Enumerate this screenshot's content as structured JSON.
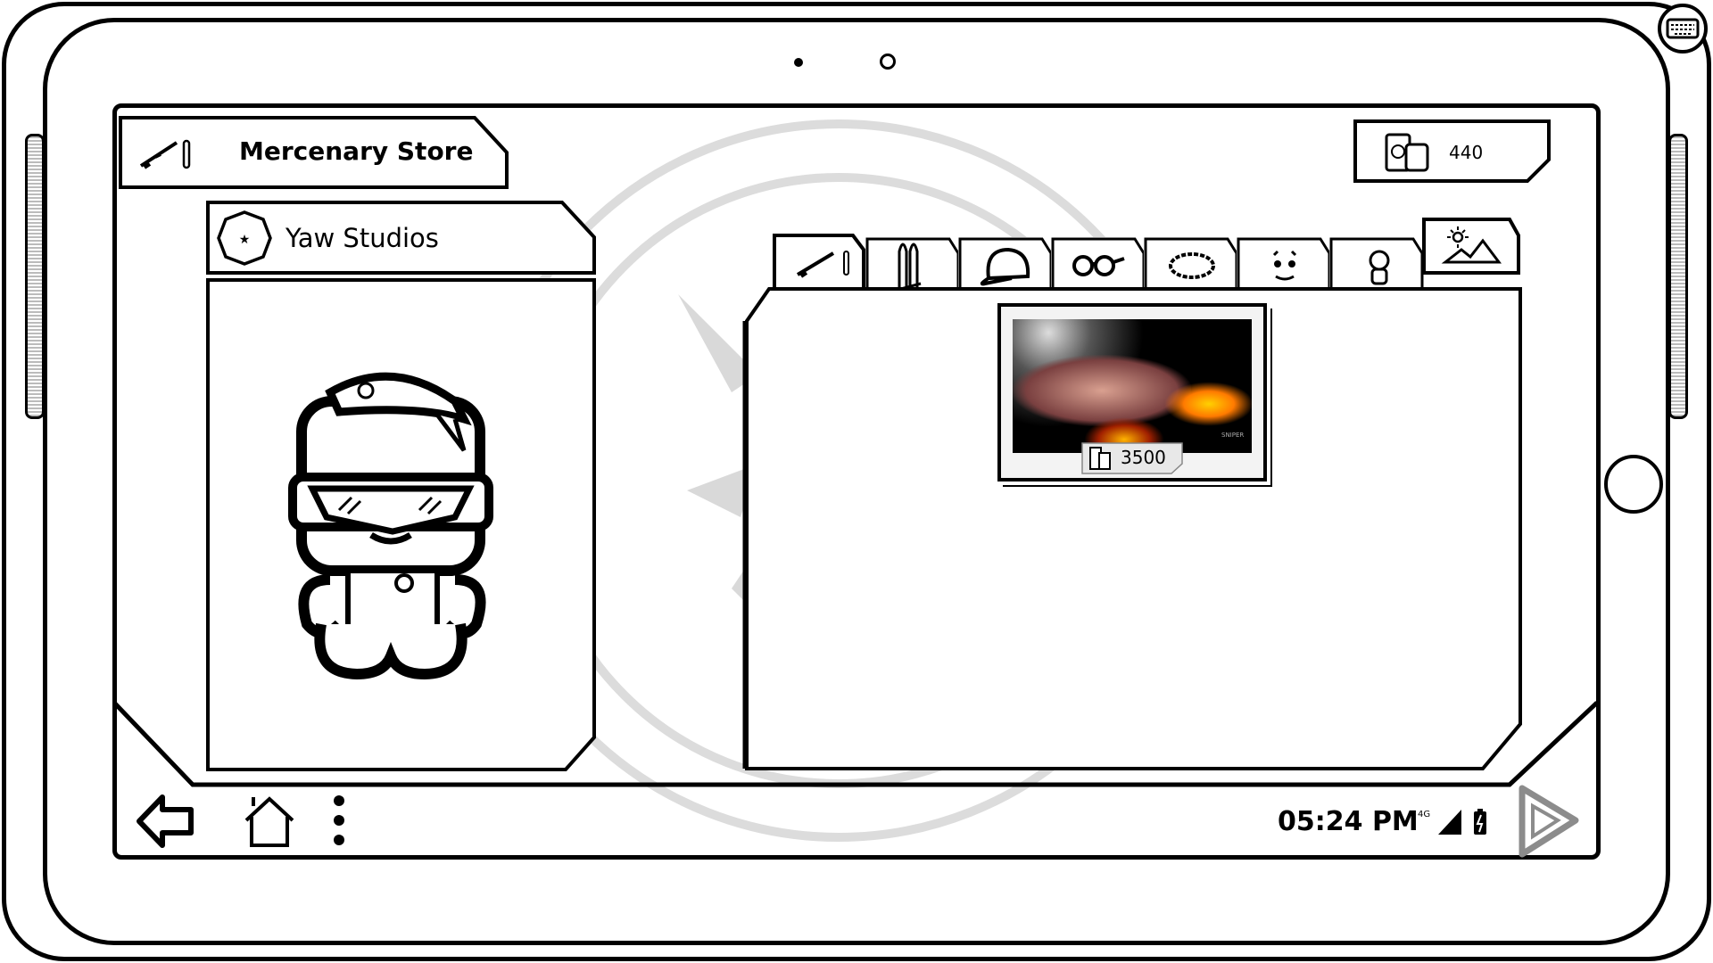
{
  "header": {
    "title": "Mercenary Store",
    "title_icon": "rifle-bullet-icon"
  },
  "studio": {
    "name": "Yaw Studios",
    "icon": "octagon-star-icon"
  },
  "currency": {
    "amount": "440",
    "icon": "cans-currency-icon"
  },
  "tabs": [
    {
      "name": "weapons",
      "icon": "rifle-bullet-icon",
      "active": true
    },
    {
      "name": "ammo",
      "icon": "bullets-icon"
    },
    {
      "name": "hats",
      "icon": "cap-icon"
    },
    {
      "name": "glasses",
      "icon": "glasses-icon"
    },
    {
      "name": "necklaces",
      "icon": "beads-icon"
    },
    {
      "name": "faces",
      "icon": "face-icon"
    },
    {
      "name": "characters",
      "icon": "character-icon"
    },
    {
      "name": "backgrounds",
      "icon": "landscape-icon"
    }
  ],
  "items": [
    {
      "price": "3500",
      "label": "SNIPER"
    }
  ],
  "status": {
    "time": "05:24 PM",
    "network": "4G"
  },
  "colors": {
    "watermark": "#d9d9d9",
    "play": "#8c8c8c",
    "frame": "#000000"
  }
}
